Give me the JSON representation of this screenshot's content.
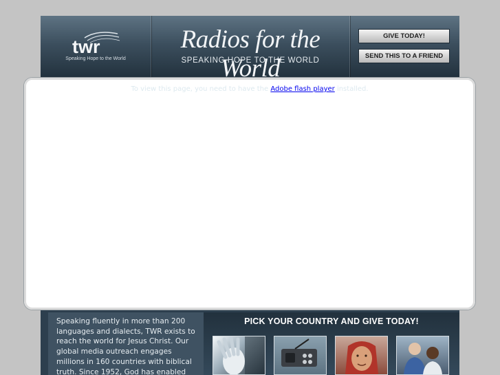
{
  "header": {
    "logo_text": "twr",
    "logo_tagline": "Speaking Hope to the World",
    "title": "Radios for the World",
    "subtitle": "SPEAKING HOPE TO THE WORLD",
    "give_button": "GIVE TODAY!",
    "send_button": "SEND THIS TO A FRIEND"
  },
  "flash": {
    "message_before": "To view this page, you need to have the ",
    "link_text": "Adobe flash player",
    "message_after": " installed."
  },
  "intro": {
    "text": "Speaking fluently in more than 200 languages and dialects, TWR exists to reach the world for Jesus Christ. Our global media outreach engages millions in 160 countries with biblical truth. Since 1952, God has enabled"
  },
  "picker": {
    "title": "PICK YOUR COUNTRY AND GIVE TODAY!",
    "thumbnails": [
      {
        "icon": "hand-face-photo"
      },
      {
        "icon": "radio-photo"
      },
      {
        "icon": "woman-photo"
      },
      {
        "icon": "listeners-photo"
      }
    ]
  },
  "colors": {
    "page_background": "#c4c4c4",
    "header_top": "#5e7383",
    "header_bottom": "#22313d",
    "intro_panel": "#3f5262",
    "link": "#0000ee"
  }
}
